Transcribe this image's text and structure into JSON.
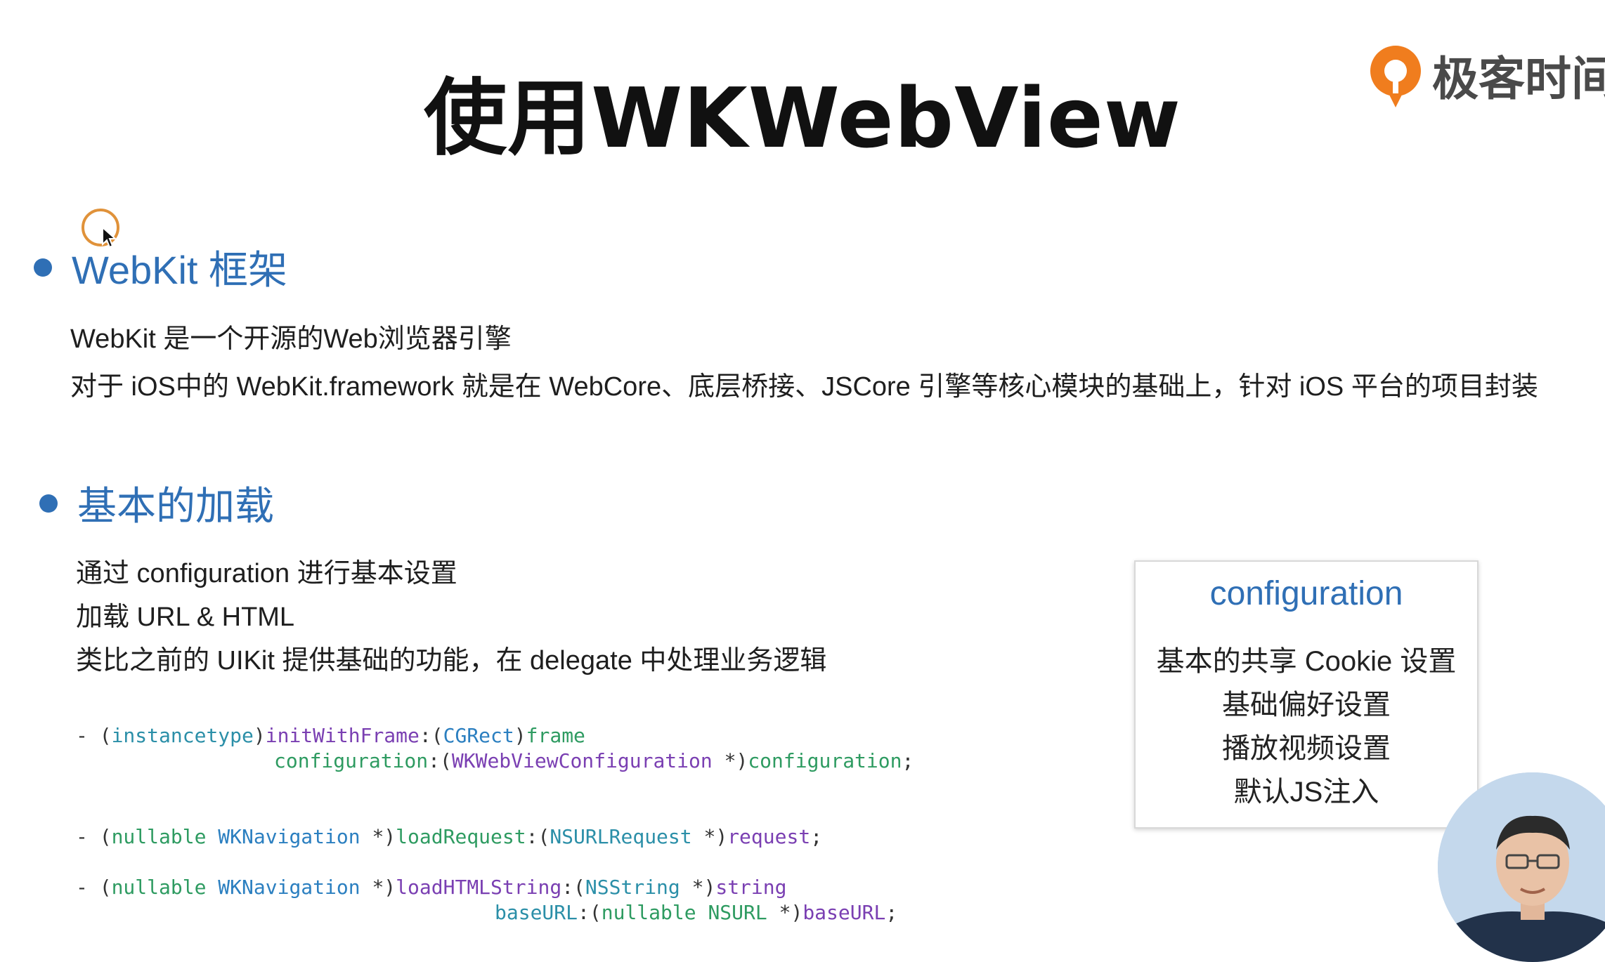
{
  "slide": {
    "title": "使用WKWebView",
    "logo_text": "极客时间"
  },
  "section1": {
    "heading": "WebKit 框架",
    "lines": [
      "WebKit 是一个开源的Web浏览器引擎",
      "对于 iOS中的 WebKit.framework 就是在 WebCore、底层桥接、JSCore 引擎等核心模块的基础上，针对 iOS 平台的项目封装"
    ]
  },
  "section2": {
    "heading": "基本的加载",
    "lines": [
      "通过 configuration 进行基本设置",
      "加载 URL & HTML",
      "类比之前的 UIKit 提供基础的功能，在 delegate 中处理业务逻辑"
    ]
  },
  "code": {
    "init": {
      "dash": "- (",
      "ret": "instancetype",
      "close": ")",
      "sel1": "initWithFrame",
      "colon1": ":(",
      "t1": "CGRect",
      "close1": ")",
      "p1": "frame",
      "sel2": "configuration",
      "colon2": ":(",
      "t2": "WKWebViewConfiguration",
      "ptr2": " *)",
      "p2": "configuration",
      "end": ";"
    },
    "load": {
      "dash": "- (",
      "nullable": "nullable",
      "type": "WKNavigation",
      "ptr": " *)",
      "sel": "loadRequest",
      "colon": ":(",
      "t": "NSURLRequest",
      "ptr2": " *)",
      "p": "request",
      "end": ";"
    },
    "html": {
      "dash": "- (",
      "nullable": "nullable",
      "type": "WKNavigation",
      "ptr": " *)",
      "sel1": "loadHTMLString",
      "colon1": ":(",
      "t1": "NSString",
      "ptr1": " *)",
      "p1": "string",
      "sel2": "baseURL",
      "colon2": ":(",
      "nullable2": "nullable",
      "t2": "NSURL",
      "ptr2": " *)",
      "p2": "baseURL",
      "end": ";"
    }
  },
  "config_box": {
    "title": "configuration",
    "items": [
      "基本的共享 Cookie 设置",
      "基础偏好设置",
      "播放视频设置",
      "默认JS注入"
    ]
  },
  "colors": {
    "accent": "#2f6fb5",
    "logo_orange": "#f07d1e"
  },
  "icons": {
    "logo": "geektime-logo-icon",
    "cursor": "mouse-cursor-icon"
  }
}
